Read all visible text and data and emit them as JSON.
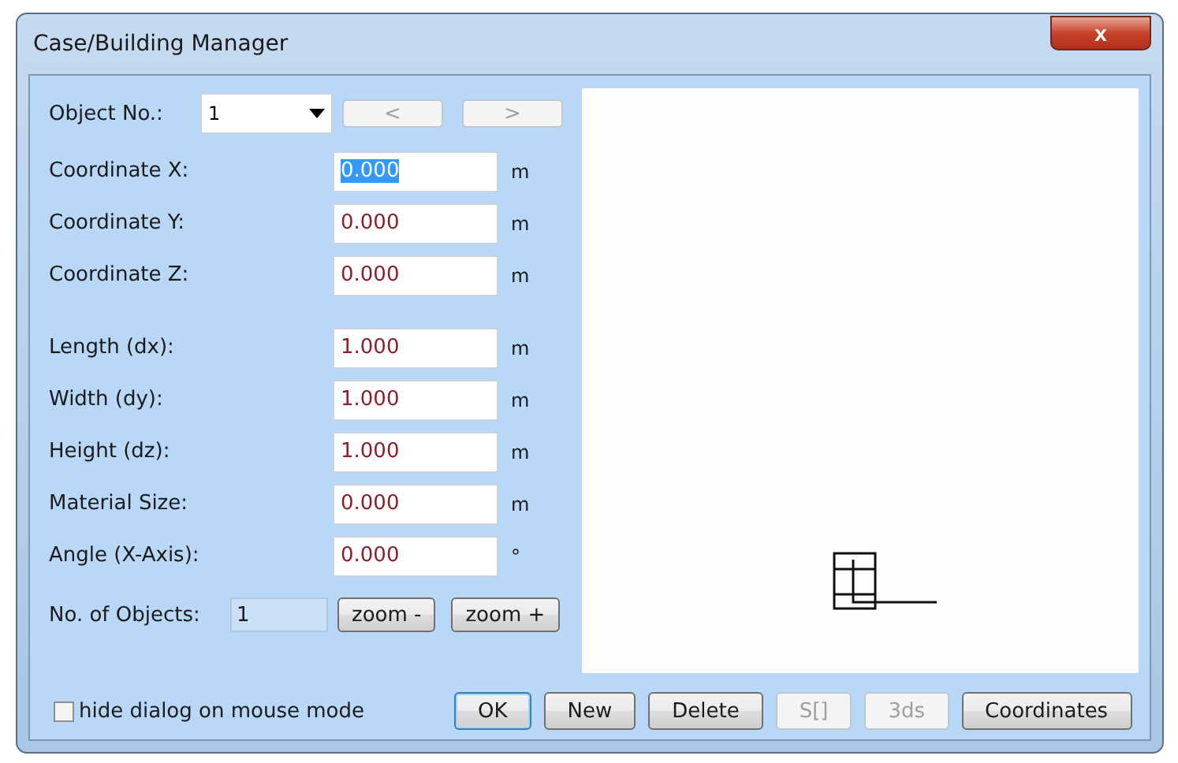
{
  "window": {
    "title": "Case/Building Manager",
    "close": "x"
  },
  "object_no": {
    "label": "Object No.:",
    "value": "1",
    "prev": {
      "label": "<",
      "disabled": true
    },
    "next": {
      "label": ">",
      "disabled": true
    }
  },
  "field_groups": [
    [
      {
        "label": "Coordinate X:",
        "value": "0.000",
        "unit": "m",
        "highlighted": true
      },
      {
        "label": "Coordinate Y:",
        "value": "0.000",
        "unit": "m",
        "highlighted": false
      },
      {
        "label": "Coordinate Z:",
        "value": "0.000",
        "unit": "m",
        "highlighted": false
      }
    ],
    [
      {
        "label": "Length (dx):",
        "value": "1.000",
        "unit": "m",
        "highlighted": false
      },
      {
        "label": "Width (dy):",
        "value": "1.000",
        "unit": "m",
        "highlighted": false
      },
      {
        "label": "Height (dz):",
        "value": "1.000",
        "unit": "m",
        "highlighted": false
      },
      {
        "label": "Material Size:",
        "value": "0.000",
        "unit": "m",
        "highlighted": false
      },
      {
        "label": "Angle (X-Axis):",
        "value": "0.000",
        "unit": "°",
        "highlighted": false
      }
    ]
  ],
  "objects_count": {
    "label": "No. of Objects:",
    "value": "1"
  },
  "zoom_buttons": [
    "zoom -",
    "zoom +"
  ],
  "hide_dialog": {
    "label": "hide dialog on mouse mode",
    "checked": false
  },
  "buttons": [
    {
      "label": "OK",
      "default": true,
      "disabled": false
    },
    {
      "label": "New",
      "default": false,
      "disabled": false
    },
    {
      "label": "Delete",
      "default": false,
      "disabled": false
    },
    {
      "label": "S[]",
      "default": false,
      "disabled": true
    },
    {
      "label": "3ds",
      "default": false,
      "disabled": true
    },
    {
      "label": "Coordinates",
      "default": false,
      "disabled": false
    }
  ]
}
